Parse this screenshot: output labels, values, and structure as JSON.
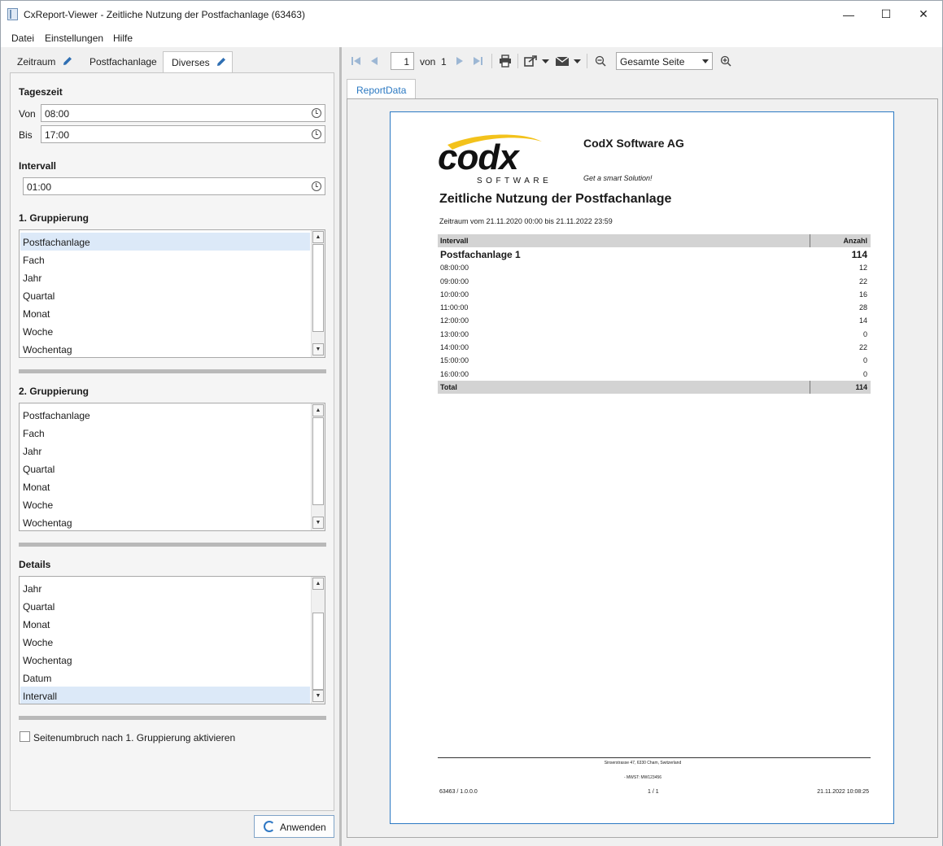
{
  "window": {
    "title": "CxReport-Viewer - Zeitliche Nutzung der Postfachanlage (63463)",
    "minimize": "—",
    "maximize": "☐",
    "close": "✕"
  },
  "menu": [
    "Datei",
    "Einstellungen",
    "Hilfe"
  ],
  "left": {
    "tabs": [
      "Zeitraum",
      "Postfachanlage",
      "Diverses"
    ],
    "tageszeit": {
      "title": "Tageszeit",
      "von_label": "Von",
      "von_value": "08:00",
      "bis_label": "Bis",
      "bis_value": "17:00"
    },
    "intervall": {
      "title": "Intervall",
      "value": "01:00"
    },
    "gruppierung1": {
      "title": "1. Gruppierung",
      "items": [
        "Postfachanlage",
        "Fach",
        "Jahr",
        "Quartal",
        "Monat",
        "Woche",
        "Wochentag"
      ],
      "selected": 0
    },
    "gruppierung2": {
      "title": "2. Gruppierung",
      "items": [
        "Postfachanlage",
        "Fach",
        "Jahr",
        "Quartal",
        "Monat",
        "Woche",
        "Wochentag"
      ],
      "selected": -1
    },
    "details": {
      "title": "Details",
      "items": [
        "Jahr",
        "Quartal",
        "Monat",
        "Woche",
        "Wochentag",
        "Datum",
        "Intervall"
      ],
      "selected": 6
    },
    "pagebreak_label": "Seitenumbruch nach 1. Gruppierung aktivieren",
    "pagebreak_checked": false,
    "apply_label": "Anwenden"
  },
  "toolbar": {
    "page_number": "1",
    "of_label": "von",
    "total_pages": "1",
    "zoom": "Gesamte Seite"
  },
  "report": {
    "tab": "ReportData",
    "logo_text": "codx",
    "logo_sub": "SOFTWARE",
    "company": "CodX Software AG",
    "slogan": "Get a smart Solution!",
    "title": "Zeitliche Nutzung der Postfachanlage",
    "period": "Zeitraum vom 21.11.2020 00:00 bis 21.11.2022 23:59",
    "table": {
      "col1": "Intervall",
      "col2": "Anzahl",
      "group_label": "Postfachanlage 1",
      "group_total": "114",
      "rows": [
        [
          "08:00:00",
          "12"
        ],
        [
          "09:00:00",
          "22"
        ],
        [
          "10:00:00",
          "16"
        ],
        [
          "11:00:00",
          "28"
        ],
        [
          "12:00:00",
          "14"
        ],
        [
          "13:00:00",
          "0"
        ],
        [
          "14:00:00",
          "22"
        ],
        [
          "15:00:00",
          "0"
        ],
        [
          "16:00:00",
          "0"
        ]
      ],
      "total_label": "Total",
      "total_value": "114"
    },
    "footer": {
      "address": "Sinserstrasse 47, 6330 Cham, Switzerland",
      "vat": "- MWST: MW123456",
      "left": "63463 / 1.0.0.0",
      "center": "1 / 1",
      "right": "21.11.2022 10:08:25"
    }
  },
  "colors": {
    "accent": "#2c7ac4",
    "selection": "#dce9f8",
    "logo_yellow": "#f3c21b"
  }
}
